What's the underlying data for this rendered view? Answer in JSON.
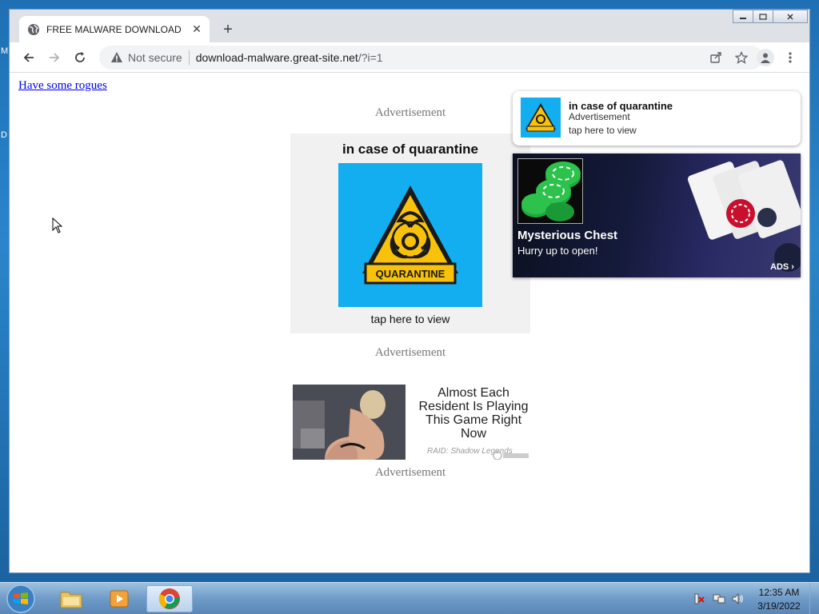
{
  "browser": {
    "tab_title": "FREE MALWARE DOWNLOAD",
    "new_tab_symbol": "+",
    "close_tab_symbol": "✕",
    "security_label": "Not secure",
    "url_host": "download-malware.great-site.net",
    "url_path": "/?i=1"
  },
  "page": {
    "link_text": "Have some rogues",
    "ad_label": "Advertisement"
  },
  "quarantine_ad": {
    "title": "in case of quarantine",
    "badge_text": "QUARANTINE",
    "cta": "tap here to view"
  },
  "raid_ad": {
    "headline_lines": [
      "Almost Each",
      "Resident Is Playing",
      "This Game Right",
      "Now"
    ],
    "source": "RAID: Shadow Legends"
  },
  "push_notification": {
    "title": "in case of quarantine",
    "subtitle": "Advertisement",
    "cta": "tap here to view"
  },
  "chest_ad": {
    "title": "Mysterious Chest",
    "subtitle": "Hurry up to open!",
    "ads_label": "ADS"
  },
  "taskbar": {
    "time": "12:35 AM",
    "date": "3/19/2022"
  },
  "colors": {
    "quarantine_bg": "#12aef0",
    "hazard_yellow": "#f9c20a",
    "link": "#0000ee"
  }
}
